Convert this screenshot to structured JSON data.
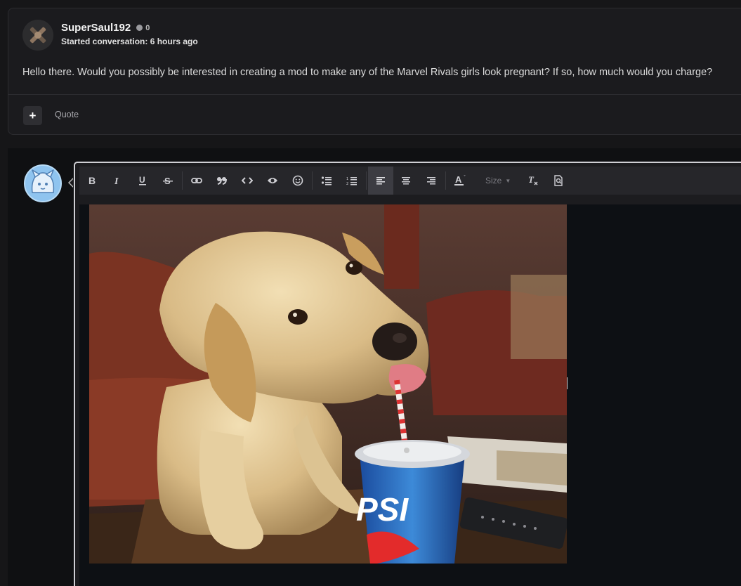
{
  "message": {
    "username": "SuperSaul192",
    "reputation": "0",
    "meta": "Started conversation: 6 hours ago",
    "body": "Hello there. Would you possibly be interested in creating a mod to make any of the Marvel Rivals girls look pregnant? If so, how much would you charge?",
    "plus_label": "+",
    "quote_label": "Quote"
  },
  "editor": {
    "toolbar": [
      {
        "name": "bold-button",
        "icon": "bold-icon",
        "glyph": "B"
      },
      {
        "name": "italic-button",
        "icon": "italic-icon",
        "glyph": "I"
      },
      {
        "name": "underline-button",
        "icon": "underline-icon",
        "glyph": "U"
      },
      {
        "name": "strikethrough-button",
        "icon": "strikethrough-icon",
        "glyph": "S"
      },
      {
        "name": "link-button",
        "icon": "link-icon"
      },
      {
        "name": "quote-button",
        "icon": "quote-icon"
      },
      {
        "name": "code-button",
        "icon": "code-icon"
      },
      {
        "name": "spoiler-button",
        "icon": "eye-icon"
      },
      {
        "name": "emoji-button",
        "icon": "smile-icon"
      },
      {
        "name": "bullet-list-button",
        "icon": "bullet-list-icon"
      },
      {
        "name": "numbered-list-button",
        "icon": "numbered-list-icon"
      },
      {
        "name": "align-left-button",
        "icon": "align-left-icon",
        "active": true
      },
      {
        "name": "align-center-button",
        "icon": "align-center-icon"
      },
      {
        "name": "align-right-button",
        "icon": "align-right-icon"
      },
      {
        "name": "text-color-button",
        "icon": "text-color-icon"
      },
      {
        "name": "clear-format-button",
        "icon": "clear-format-icon"
      },
      {
        "name": "preview-button",
        "icon": "preview-icon"
      }
    ],
    "size_label": "Size",
    "accent_colors": {
      "active_button": "#3c3c42",
      "text_color_bar": "#d9534f"
    }
  }
}
